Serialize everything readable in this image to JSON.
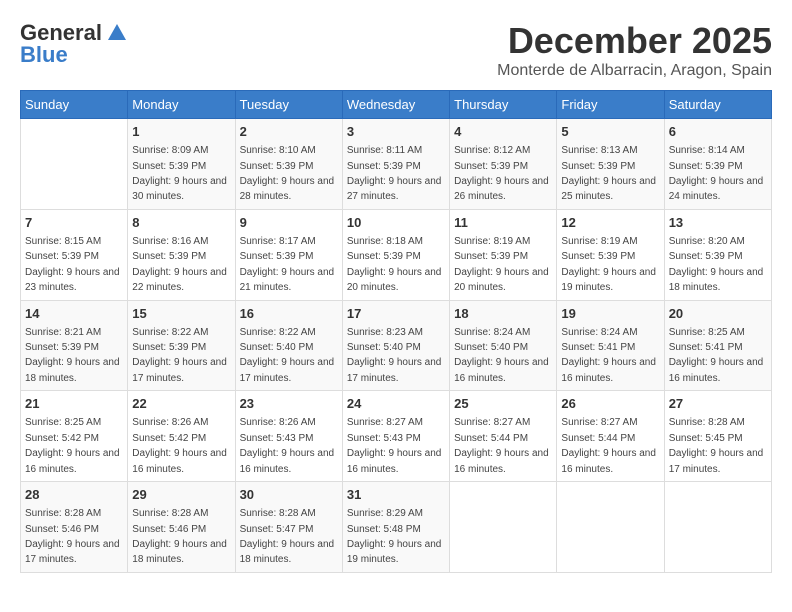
{
  "header": {
    "logo_general": "General",
    "logo_blue": "Blue",
    "month": "December 2025",
    "location": "Monterde de Albarracin, Aragon, Spain"
  },
  "weekdays": [
    "Sunday",
    "Monday",
    "Tuesday",
    "Wednesday",
    "Thursday",
    "Friday",
    "Saturday"
  ],
  "weeks": [
    [
      {
        "day": "",
        "sunrise": "",
        "sunset": "",
        "daylight": ""
      },
      {
        "day": "1",
        "sunrise": "Sunrise: 8:09 AM",
        "sunset": "Sunset: 5:39 PM",
        "daylight": "Daylight: 9 hours and 30 minutes."
      },
      {
        "day": "2",
        "sunrise": "Sunrise: 8:10 AM",
        "sunset": "Sunset: 5:39 PM",
        "daylight": "Daylight: 9 hours and 28 minutes."
      },
      {
        "day": "3",
        "sunrise": "Sunrise: 8:11 AM",
        "sunset": "Sunset: 5:39 PM",
        "daylight": "Daylight: 9 hours and 27 minutes."
      },
      {
        "day": "4",
        "sunrise": "Sunrise: 8:12 AM",
        "sunset": "Sunset: 5:39 PM",
        "daylight": "Daylight: 9 hours and 26 minutes."
      },
      {
        "day": "5",
        "sunrise": "Sunrise: 8:13 AM",
        "sunset": "Sunset: 5:39 PM",
        "daylight": "Daylight: 9 hours and 25 minutes."
      },
      {
        "day": "6",
        "sunrise": "Sunrise: 8:14 AM",
        "sunset": "Sunset: 5:39 PM",
        "daylight": "Daylight: 9 hours and 24 minutes."
      }
    ],
    [
      {
        "day": "7",
        "sunrise": "Sunrise: 8:15 AM",
        "sunset": "Sunset: 5:39 PM",
        "daylight": "Daylight: 9 hours and 23 minutes."
      },
      {
        "day": "8",
        "sunrise": "Sunrise: 8:16 AM",
        "sunset": "Sunset: 5:39 PM",
        "daylight": "Daylight: 9 hours and 22 minutes."
      },
      {
        "day": "9",
        "sunrise": "Sunrise: 8:17 AM",
        "sunset": "Sunset: 5:39 PM",
        "daylight": "Daylight: 9 hours and 21 minutes."
      },
      {
        "day": "10",
        "sunrise": "Sunrise: 8:18 AM",
        "sunset": "Sunset: 5:39 PM",
        "daylight": "Daylight: 9 hours and 20 minutes."
      },
      {
        "day": "11",
        "sunrise": "Sunrise: 8:19 AM",
        "sunset": "Sunset: 5:39 PM",
        "daylight": "Daylight: 9 hours and 20 minutes."
      },
      {
        "day": "12",
        "sunrise": "Sunrise: 8:19 AM",
        "sunset": "Sunset: 5:39 PM",
        "daylight": "Daylight: 9 hours and 19 minutes."
      },
      {
        "day": "13",
        "sunrise": "Sunrise: 8:20 AM",
        "sunset": "Sunset: 5:39 PM",
        "daylight": "Daylight: 9 hours and 18 minutes."
      }
    ],
    [
      {
        "day": "14",
        "sunrise": "Sunrise: 8:21 AM",
        "sunset": "Sunset: 5:39 PM",
        "daylight": "Daylight: 9 hours and 18 minutes."
      },
      {
        "day": "15",
        "sunrise": "Sunrise: 8:22 AM",
        "sunset": "Sunset: 5:39 PM",
        "daylight": "Daylight: 9 hours and 17 minutes."
      },
      {
        "day": "16",
        "sunrise": "Sunrise: 8:22 AM",
        "sunset": "Sunset: 5:40 PM",
        "daylight": "Daylight: 9 hours and 17 minutes."
      },
      {
        "day": "17",
        "sunrise": "Sunrise: 8:23 AM",
        "sunset": "Sunset: 5:40 PM",
        "daylight": "Daylight: 9 hours and 17 minutes."
      },
      {
        "day": "18",
        "sunrise": "Sunrise: 8:24 AM",
        "sunset": "Sunset: 5:40 PM",
        "daylight": "Daylight: 9 hours and 16 minutes."
      },
      {
        "day": "19",
        "sunrise": "Sunrise: 8:24 AM",
        "sunset": "Sunset: 5:41 PM",
        "daylight": "Daylight: 9 hours and 16 minutes."
      },
      {
        "day": "20",
        "sunrise": "Sunrise: 8:25 AM",
        "sunset": "Sunset: 5:41 PM",
        "daylight": "Daylight: 9 hours and 16 minutes."
      }
    ],
    [
      {
        "day": "21",
        "sunrise": "Sunrise: 8:25 AM",
        "sunset": "Sunset: 5:42 PM",
        "daylight": "Daylight: 9 hours and 16 minutes."
      },
      {
        "day": "22",
        "sunrise": "Sunrise: 8:26 AM",
        "sunset": "Sunset: 5:42 PM",
        "daylight": "Daylight: 9 hours and 16 minutes."
      },
      {
        "day": "23",
        "sunrise": "Sunrise: 8:26 AM",
        "sunset": "Sunset: 5:43 PM",
        "daylight": "Daylight: 9 hours and 16 minutes."
      },
      {
        "day": "24",
        "sunrise": "Sunrise: 8:27 AM",
        "sunset": "Sunset: 5:43 PM",
        "daylight": "Daylight: 9 hours and 16 minutes."
      },
      {
        "day": "25",
        "sunrise": "Sunrise: 8:27 AM",
        "sunset": "Sunset: 5:44 PM",
        "daylight": "Daylight: 9 hours and 16 minutes."
      },
      {
        "day": "26",
        "sunrise": "Sunrise: 8:27 AM",
        "sunset": "Sunset: 5:44 PM",
        "daylight": "Daylight: 9 hours and 16 minutes."
      },
      {
        "day": "27",
        "sunrise": "Sunrise: 8:28 AM",
        "sunset": "Sunset: 5:45 PM",
        "daylight": "Daylight: 9 hours and 17 minutes."
      }
    ],
    [
      {
        "day": "28",
        "sunrise": "Sunrise: 8:28 AM",
        "sunset": "Sunset: 5:46 PM",
        "daylight": "Daylight: 9 hours and 17 minutes."
      },
      {
        "day": "29",
        "sunrise": "Sunrise: 8:28 AM",
        "sunset": "Sunset: 5:46 PM",
        "daylight": "Daylight: 9 hours and 18 minutes."
      },
      {
        "day": "30",
        "sunrise": "Sunrise: 8:28 AM",
        "sunset": "Sunset: 5:47 PM",
        "daylight": "Daylight: 9 hours and 18 minutes."
      },
      {
        "day": "31",
        "sunrise": "Sunrise: 8:29 AM",
        "sunset": "Sunset: 5:48 PM",
        "daylight": "Daylight: 9 hours and 19 minutes."
      },
      {
        "day": "",
        "sunrise": "",
        "sunset": "",
        "daylight": ""
      },
      {
        "day": "",
        "sunrise": "",
        "sunset": "",
        "daylight": ""
      },
      {
        "day": "",
        "sunrise": "",
        "sunset": "",
        "daylight": ""
      }
    ]
  ]
}
